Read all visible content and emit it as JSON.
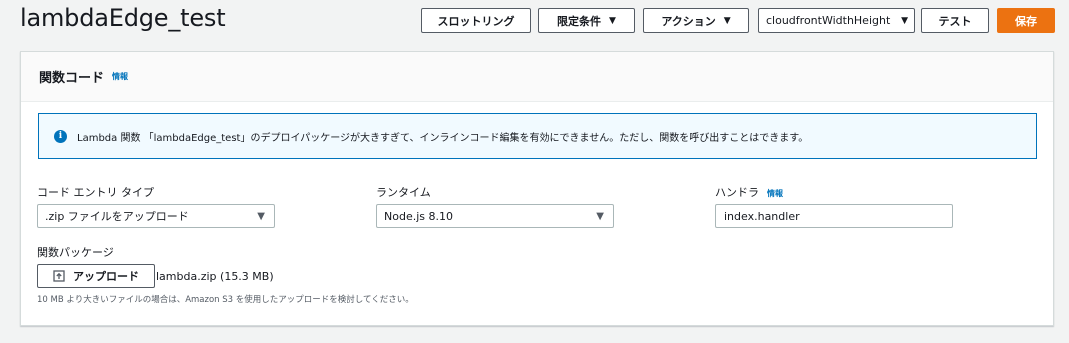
{
  "header": {
    "title": "lambdaEdge_test"
  },
  "toolbar": {
    "throttle_label": "スロットリング",
    "qualifiers_label": "限定条件",
    "actions_label": "アクション",
    "test_event_value": "cloudfrontWidthHeight",
    "test_label": "テスト",
    "save_label": "保存",
    "primary_color": "#ec7211"
  },
  "panel": {
    "title": "関数コード",
    "info_link": "情報",
    "alert": {
      "icon": "info-icon",
      "text": "Lambda 関数 「lambdaEdge_test」のデプロイパッケージが大きすぎて、インラインコード編集を有効にできません。ただし、関数を呼び出すことはできます。"
    },
    "code_entry": {
      "label": "コード エントリ タイプ",
      "value": ".zip ファイルをアップロード"
    },
    "runtime": {
      "label": "ランタイム",
      "value": "Node.js 8.10"
    },
    "handler": {
      "label": "ハンドラ",
      "info_link": "情報",
      "value": "index.handler"
    },
    "package": {
      "label": "関数パッケージ",
      "upload_label": "アップロード",
      "upload_icon": "upload-icon",
      "file_name": "lambda.zip (15.3 MB)",
      "hint": "10 MB より大きいファイルの場合は、Amazon S3 を使用したアップロードを検討してください。"
    }
  }
}
